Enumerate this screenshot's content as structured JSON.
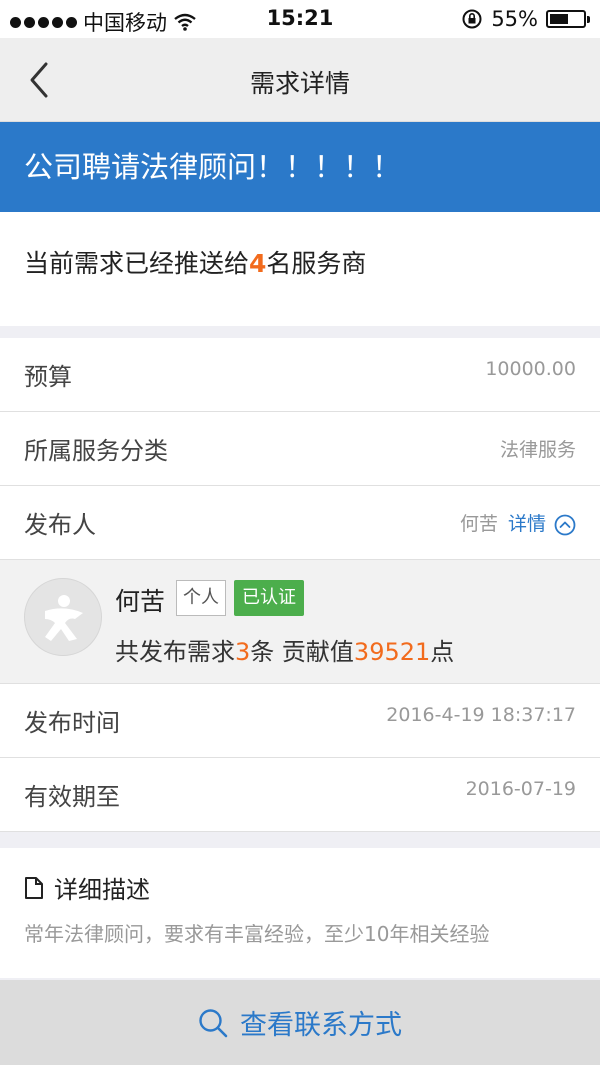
{
  "status_bar": {
    "carrier": "中国移动",
    "time": "15:21",
    "battery": "55%",
    "battery_level": 0.55
  },
  "nav": {
    "title": "需求详情",
    "back_icon": "chevron-left-icon"
  },
  "request": {
    "title": "公司聘请法律顾问！！！！！",
    "pushed_prefix": "当前需求已经推送给",
    "pushed_count": "4",
    "pushed_suffix": "名服务商"
  },
  "details": {
    "budget_label": "预算",
    "budget_value": "10000.00",
    "category_label": "所属服务分类",
    "category_value": "法律服务",
    "publisher_label": "发布人",
    "publisher_value": "何苦",
    "publisher_detail_link": "详情",
    "publish_time_label": "发布时间",
    "publish_time_value": "2016-4-19 18:37:17",
    "valid_until_label": "有效期至",
    "valid_until_value": "2016-07-19"
  },
  "publisher": {
    "name": "何苦",
    "type_badge": "个人",
    "verified_badge": "已认证",
    "stats_prefix": "共发布需求",
    "requests_count": "3",
    "stats_mid": "条 贡献值",
    "contribution": "39521",
    "stats_suffix": "点"
  },
  "description": {
    "title": "详细描述",
    "text": "常年法律顾问，要求有丰富经验，至少10年相关经验"
  },
  "action": {
    "contact_label": "查看联系方式"
  },
  "colors": {
    "accent_blue": "#2b79c9",
    "highlight_orange": "#f26b1d",
    "verified_green": "#4cae4c"
  }
}
